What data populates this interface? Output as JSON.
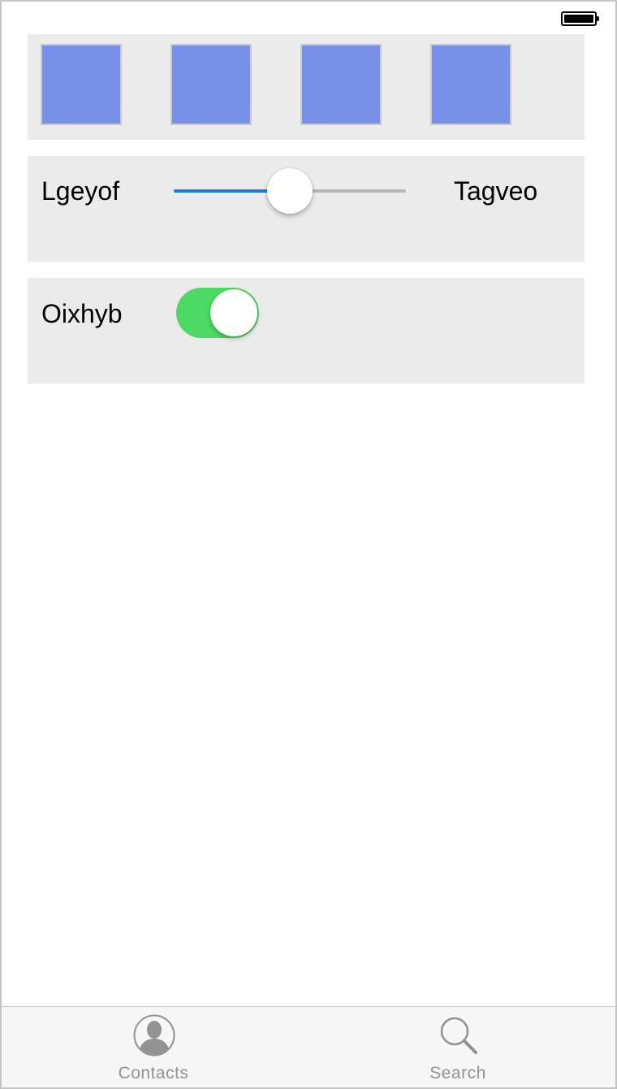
{
  "status_bar": {
    "battery_icon": "battery-full-icon"
  },
  "color_swatches": {
    "color": "#7890e6",
    "items": [
      "swatch",
      "swatch",
      "swatch",
      "swatch"
    ]
  },
  "slider_row": {
    "min_label": "Lgeyof",
    "max_label": "Tagveo",
    "value_fraction": 0.5,
    "fill_color": "#1a7ae6",
    "track_color": "#b6b6b6"
  },
  "switch_row": {
    "label": "Oixhyb",
    "state": "on",
    "on_color": "#4cd964"
  },
  "tab_bar": {
    "tabs": [
      {
        "label": "Contacts",
        "icon": "contact-person-icon"
      },
      {
        "label": "Search",
        "icon": "magnifier-search-icon"
      }
    ]
  }
}
